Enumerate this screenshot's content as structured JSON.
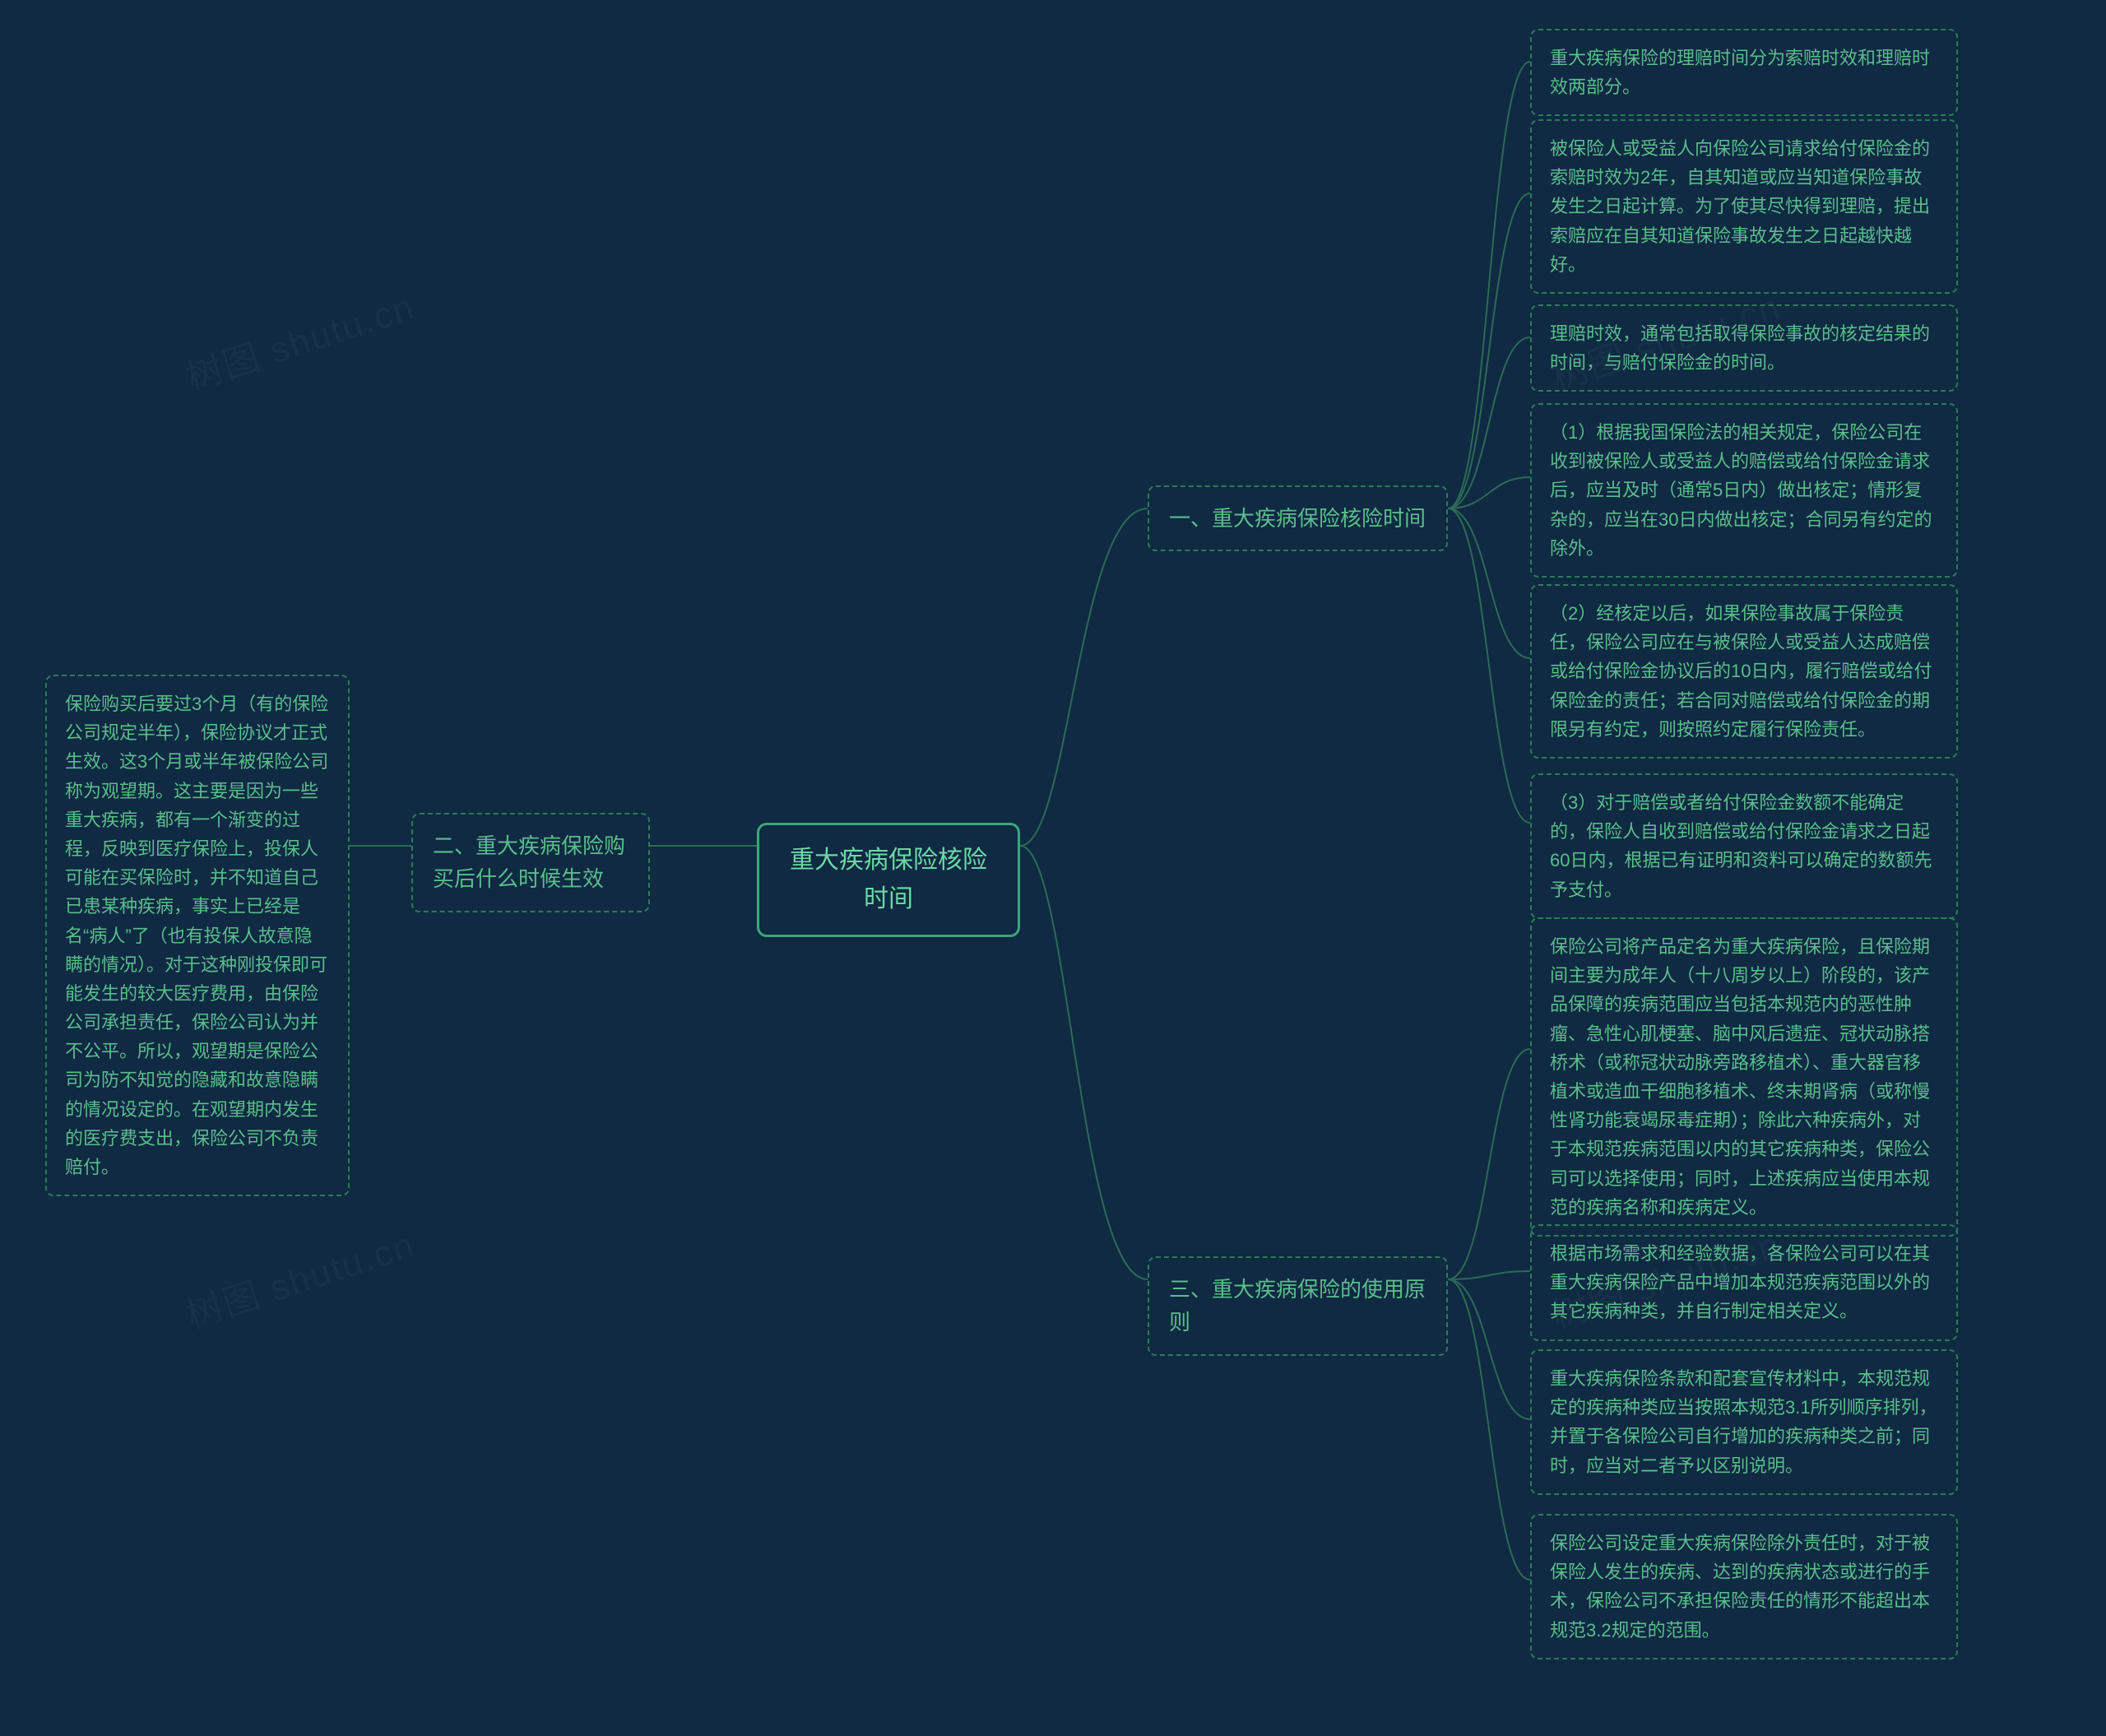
{
  "watermark": "树图 shutu.cn",
  "center": {
    "title": "重大疾病保险核险时间"
  },
  "branch1": {
    "title": "一、重大疾病保险核险时间",
    "leaves": {
      "l1": "重大疾病保险的理赔时间分为索赔时效和理赔时效两部分。",
      "l2": "被保险人或受益人向保险公司请求给付保险金的索赔时效为2年，自其知道或应当知道保险事故发生之日起计算。为了使其尽快得到理赔，提出索赔应在自其知道保险事故发生之日起越快越好。",
      "l3": "理赔时效，通常包括取得保险事故的核定结果的时间，与赔付保险金的时间。",
      "l4": "（1）根据我国保险法的相关规定，保险公司在收到被保险人或受益人的赔偿或给付保险金请求后，应当及时（通常5日内）做出核定；情形复杂的，应当在30日内做出核定；合同另有约定的除外。",
      "l5": "（2）经核定以后，如果保险事故属于保险责任，保险公司应在与被保险人或受益人达成赔偿或给付保险金协议后的10日内，履行赔偿或给付保险金的责任；若合同对赔偿或给付保险金的期限另有约定，则按照约定履行保险责任。",
      "l6": "（3）对于赔偿或者给付保险金数额不能确定的，保险人自收到赔偿或给付保险金请求之日起60日内，根据已有证明和资料可以确定的数额先予支付。"
    }
  },
  "branch2": {
    "title": "二、重大疾病保险购买后什么时候生效",
    "leaves": {
      "l1": "保险购买后要过3个月（有的保险公司规定半年），保险协议才正式生效。这3个月或半年被保险公司称为观望期。这主要是因为一些重大疾病，都有一个渐变的过程，反映到医疗保险上，投保人可能在买保险时，并不知道自己已患某种疾病，事实上已经是名“病人”了（也有投保人故意隐瞒的情况）。对于这种刚投保即可能发生的较大医疗费用，由保险公司承担责任，保险公司认为并不公平。所以，观望期是保险公司为防不知觉的隐藏和故意隐瞒的情况设定的。在观望期内发生的医疗费支出，保险公司不负责赔付。"
    }
  },
  "branch3": {
    "title": "三、重大疾病保险的使用原则",
    "leaves": {
      "l1": "保险公司将产品定名为重大疾病保险，且保险期间主要为成年人（十八周岁以上）阶段的，该产品保障的疾病范围应当包括本规范内的恶性肿瘤、急性心肌梗塞、脑中风后遗症、冠状动脉搭桥术（或称冠状动脉旁路移植术）、重大器官移植术或造血干细胞移植术、终末期肾病（或称慢性肾功能衰竭尿毒症期）；除此六种疾病外，对于本规范疾病范围以内的其它疾病种类，保险公司可以选择使用；同时，上述疾病应当使用本规范的疾病名称和疾病定义。",
      "l2": "根据市场需求和经验数据，各保险公司可以在其重大疾病保险产品中增加本规范疾病范围以外的其它疾病种类，并自行制定相关定义。",
      "l3": "重大疾病保险条款和配套宣传材料中，本规范规定的疾病种类应当按照本规范3.1所列顺序排列，并置于各保险公司自行增加的疾病种类之前；同时，应当对二者予以区别说明。",
      "l4": "保险公司设定重大疾病保险除外责任时，对于被保险人发生的疾病、达到的疾病状态或进行的手术，保险公司不承担保险责任的情形不能超出本规范3.2规定的范围。"
    }
  }
}
